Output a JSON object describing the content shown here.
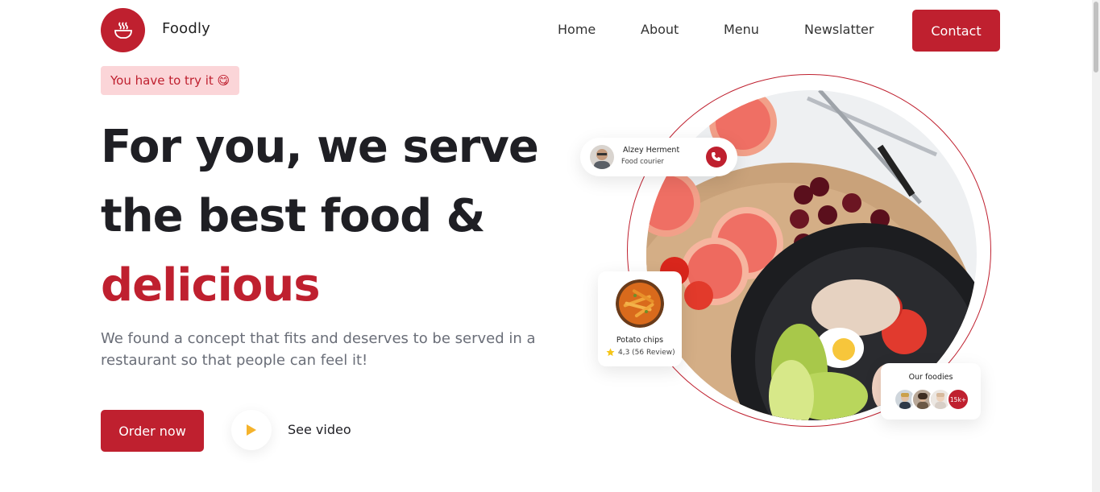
{
  "header": {
    "brand": "Foodly",
    "logo_icon": "bowl-steam-icon",
    "nav": [
      "Home",
      "About",
      "Menu",
      "Newslatter"
    ],
    "contact_label": "Contact"
  },
  "hero": {
    "tag": "You have to try it 😋",
    "headline_line1": "For you, we serve",
    "headline_line2": "the best food &",
    "headline_accent": "delicious",
    "description": "We found a concept that fits and deserves to be served in a restaurant so that people can feel it!",
    "order_label": "Order now",
    "video_label": "See video"
  },
  "courier": {
    "name": "Alzey Herment",
    "role": "Food courier"
  },
  "dish": {
    "name": "Potato chips",
    "rating": "4,3 (56 Review)"
  },
  "foodies": {
    "title": "Our foodies",
    "count": "15k+"
  },
  "colors": {
    "accent": "#bf202f",
    "tag_bg": "#fbd5d8",
    "text_dark": "#1f1f24",
    "text_muted": "#6a6e78"
  }
}
